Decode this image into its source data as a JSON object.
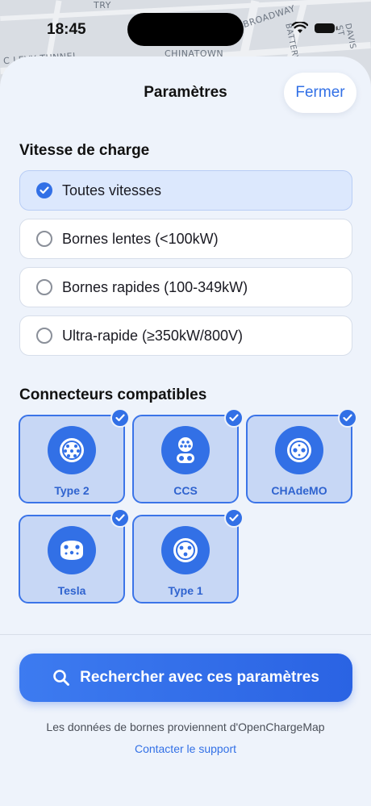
{
  "status": {
    "time": "18:45"
  },
  "map": {
    "labels": [
      "CHINATOWN",
      "BROADWAY",
      "C LEVY TUNNEL",
      "BATTERY ST",
      "DAVIS ST",
      "TRY"
    ]
  },
  "header": {
    "title": "Paramètres",
    "close_label": "Fermer"
  },
  "speed": {
    "title": "Vitesse de charge",
    "options": [
      {
        "label": "Toutes vitesses",
        "selected": true
      },
      {
        "label": "Bornes lentes (<100kW)",
        "selected": false
      },
      {
        "label": "Bornes rapides (100-349kW)",
        "selected": false
      },
      {
        "label": "Ultra-rapide (≥350kW/800V)",
        "selected": false
      }
    ]
  },
  "connectors": {
    "title": "Connecteurs compatibles",
    "items": [
      {
        "label": "Type 2",
        "icon": "type2-plug-icon",
        "selected": true
      },
      {
        "label": "CCS",
        "icon": "ccs-plug-icon",
        "selected": true
      },
      {
        "label": "CHAdeMO",
        "icon": "chademo-plug-icon",
        "selected": true
      },
      {
        "label": "Tesla",
        "icon": "tesla-plug-icon",
        "selected": true
      },
      {
        "label": "Type 1",
        "icon": "type1-plug-icon",
        "selected": true
      }
    ]
  },
  "actions": {
    "search_label": "Rechercher avec ces paramètres"
  },
  "footer": {
    "note": "Les données de bornes proviennent d'OpenChargeMap",
    "support_label": "Contacter le support"
  },
  "colors": {
    "accent": "#3270e6",
    "sheet_bg": "#eef3fb",
    "selected_bg": "#dce8fd"
  }
}
